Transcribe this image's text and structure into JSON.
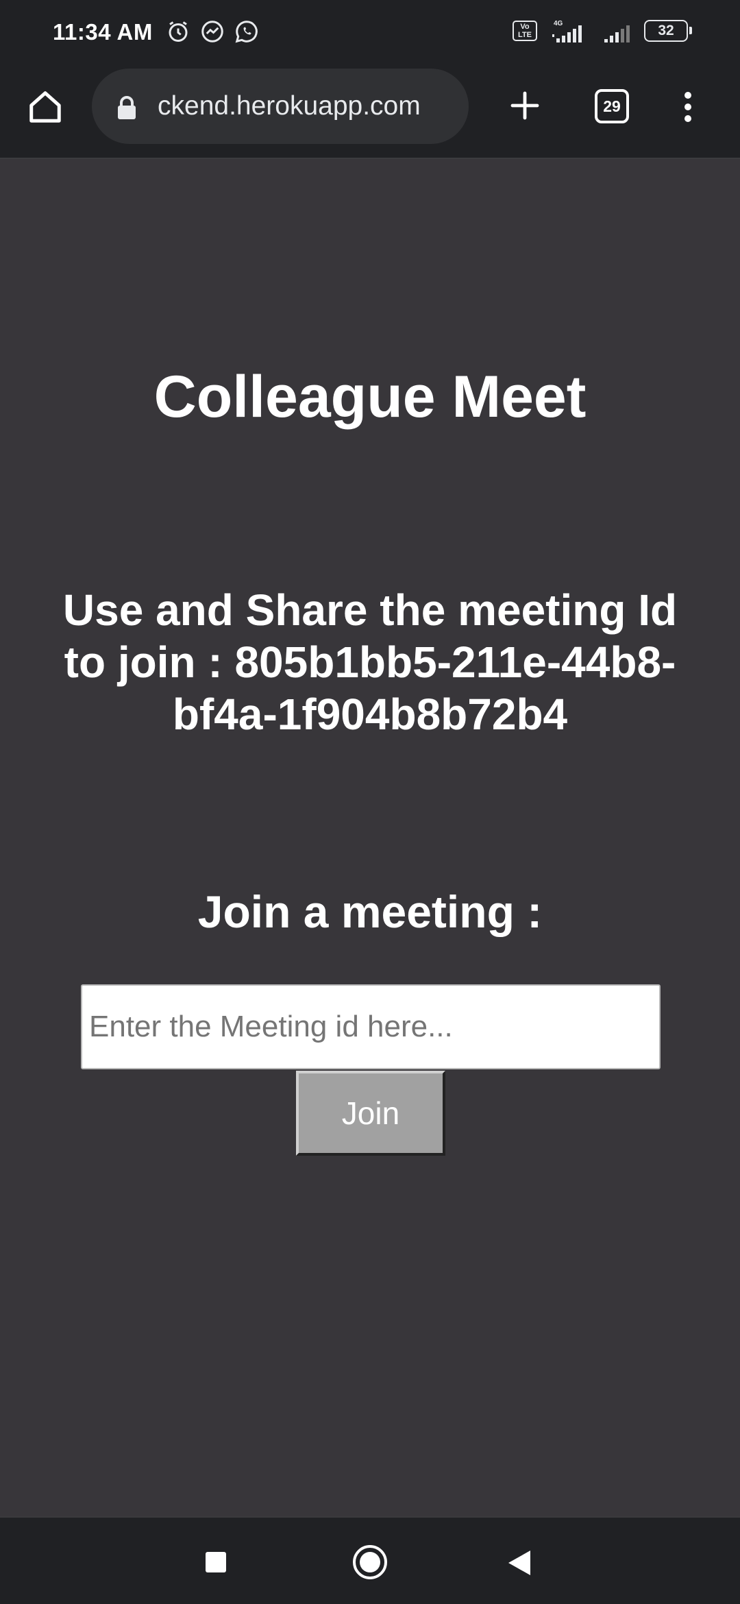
{
  "status_bar": {
    "time": "11:34 AM",
    "left_icons": [
      "alarm-icon",
      "messenger-icon",
      "whatsapp-icon"
    ],
    "network": "4G",
    "volte_label": "Vo LTE",
    "battery": "32"
  },
  "browser": {
    "url": "ckend.herokuapp.com",
    "tab_count": "29"
  },
  "page": {
    "title": "Colleague Meet",
    "share_text": "Use and Share the meeting Id to join : 805b1bb5-211e-44b8-bf4a-1f904b8b72b4",
    "join_heading": "Join a meeting :",
    "input_placeholder": "Enter the Meeting id here...",
    "input_value": "",
    "join_button": "Join"
  },
  "colors": {
    "page_background": "#38363a",
    "browser_chrome": "#202124",
    "button_background": "#a1a1a1",
    "text": "#ffffff"
  }
}
